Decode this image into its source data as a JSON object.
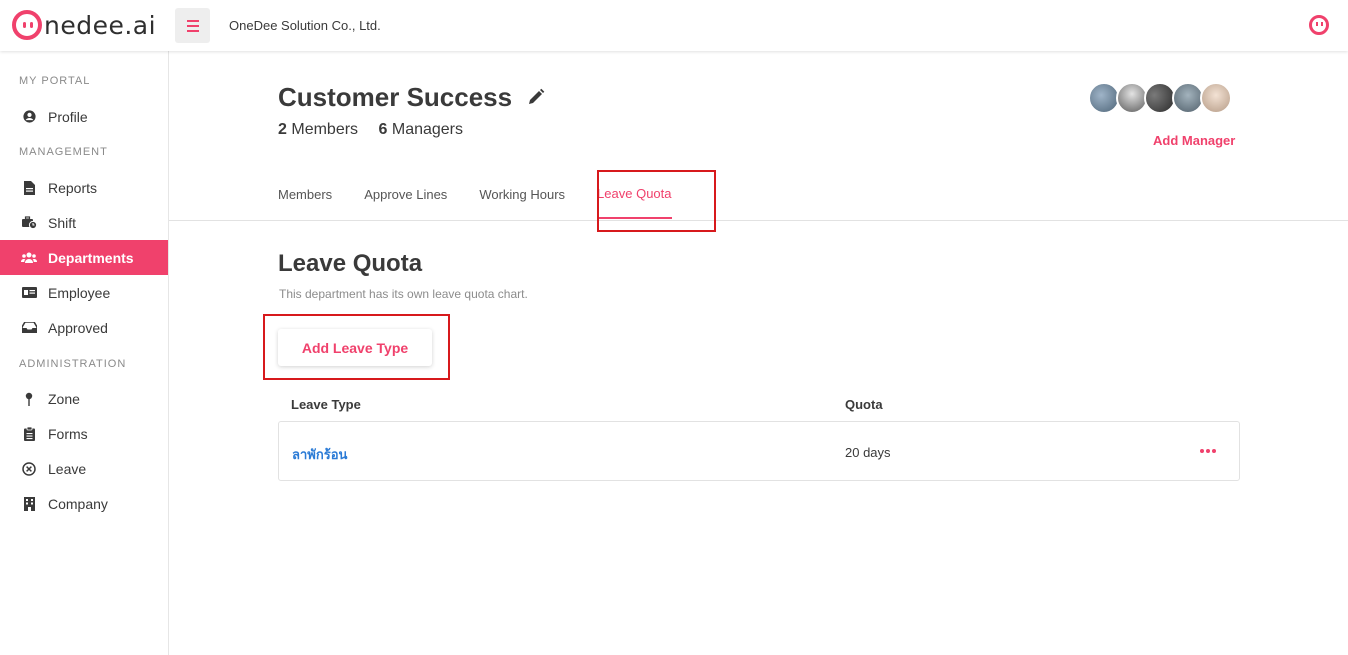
{
  "header": {
    "logo_text": "nedee.ai",
    "company": "OneDee Solution Co., Ltd.",
    "accent": "#f0416c"
  },
  "sidebar": {
    "sections": [
      {
        "label": "MY PORTAL"
      },
      {
        "label": "MANAGEMENT"
      },
      {
        "label": "ADMINISTRATION"
      }
    ],
    "items": [
      {
        "label": "Profile",
        "icon": "user-circle-icon"
      },
      {
        "label": "Reports",
        "icon": "document-icon"
      },
      {
        "label": "Shift",
        "icon": "briefcase-clock-icon"
      },
      {
        "label": "Departments",
        "icon": "users-icon",
        "active": true
      },
      {
        "label": "Employee",
        "icon": "id-card-icon"
      },
      {
        "label": "Approved",
        "icon": "inbox-icon"
      },
      {
        "label": "Zone",
        "icon": "pin-icon"
      },
      {
        "label": "Forms",
        "icon": "clipboard-icon"
      },
      {
        "label": "Leave",
        "icon": "close-circle-icon"
      },
      {
        "label": "Company",
        "icon": "building-icon"
      }
    ]
  },
  "department": {
    "title": "Customer Success",
    "members_count": "2",
    "members_label": "Members",
    "managers_count": "6",
    "managers_label": "Managers",
    "add_manager": "Add Manager"
  },
  "tabs": [
    {
      "label": "Members"
    },
    {
      "label": "Approve Lines"
    },
    {
      "label": "Working Hours"
    },
    {
      "label": "Leave Quota",
      "active": true
    }
  ],
  "leave_quota": {
    "title": "Leave Quota",
    "description": "This department has its own leave quota chart.",
    "add_button": "Add Leave Type",
    "columns": {
      "type": "Leave Type",
      "quota": "Quota"
    },
    "rows": [
      {
        "type": "ลาพักร้อน",
        "quota": "20 days"
      }
    ]
  }
}
